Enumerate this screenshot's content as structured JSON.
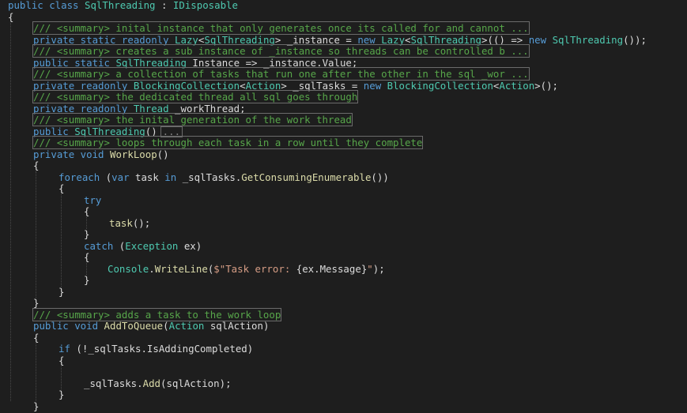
{
  "editor": {
    "lines": [
      [
        [
          "kw",
          "public class "
        ],
        [
          "ty",
          "SqlThreading"
        ],
        [
          "pn",
          " : "
        ],
        [
          "ty",
          "IDisposable"
        ]
      ],
      [
        [
          "pn",
          "{"
        ]
      ],
      [
        [
          "cm",
          "/// <summary> inital instance that only generates once its called for and cannot ..."
        ]
      ],
      [
        [
          "kw",
          "private static readonly "
        ],
        [
          "ty",
          "Lazy"
        ],
        [
          "pn",
          "<"
        ],
        [
          "ty",
          "SqlThreading"
        ],
        [
          "pn",
          "> "
        ],
        [
          "id",
          "_instance"
        ],
        [
          "pn",
          " = "
        ],
        [
          "kw",
          "new "
        ],
        [
          "ty",
          "Lazy"
        ],
        [
          "pn",
          "<"
        ],
        [
          "ty",
          "SqlThreading"
        ],
        [
          "pn",
          ">(() => "
        ],
        [
          "kw",
          "new "
        ],
        [
          "ty",
          "SqlThreading"
        ],
        [
          "pn",
          "());"
        ]
      ],
      [
        [
          "cm",
          "/// <summary> creates a sub instance of _instance so threads can be controlled b ..."
        ]
      ],
      [
        [
          "kw",
          "public static "
        ],
        [
          "ty",
          "SqlThreading"
        ],
        [
          "id",
          " Instance"
        ],
        [
          "pn",
          " => "
        ],
        [
          "id",
          "_instance"
        ],
        [
          "pn",
          "."
        ],
        [
          "id",
          "Value"
        ],
        [
          "pn",
          ";"
        ]
      ],
      [
        [
          "cm",
          "/// <summary> a collection of tasks that run one after the other in the sql _wor ..."
        ]
      ],
      [
        [
          "kw",
          "private readonly "
        ],
        [
          "ty",
          "BlockingCollection"
        ],
        [
          "pn",
          "<"
        ],
        [
          "ty",
          "Action"
        ],
        [
          "pn",
          "> "
        ],
        [
          "id",
          "_sqlTasks"
        ],
        [
          "pn",
          " = "
        ],
        [
          "kw",
          "new "
        ],
        [
          "ty",
          "BlockingCollection"
        ],
        [
          "pn",
          "<"
        ],
        [
          "ty",
          "Action"
        ],
        [
          "pn",
          ">();"
        ]
      ],
      [
        [
          "cm",
          "/// <summary> the dedicated thread all sql goes through"
        ]
      ],
      [
        [
          "kw",
          "private readonly "
        ],
        [
          "ty",
          "Thread"
        ],
        [
          "id",
          " _workThread"
        ],
        [
          "pn",
          ";"
        ]
      ],
      [
        [
          "cm",
          "/// <summary> the inital generation of the work thread"
        ]
      ],
      [
        [
          "kw",
          "public "
        ],
        [
          "ty",
          "SqlThreading"
        ],
        [
          "pn",
          "()"
        ]
      ],
      [
        [
          "cm",
          "/// <summary> loops through each task in a row until they complete"
        ]
      ],
      [
        [
          "kw",
          "private void "
        ],
        [
          "mt",
          "WorkLoop"
        ],
        [
          "pn",
          "()"
        ]
      ],
      [
        [
          "pn",
          "{"
        ]
      ],
      [
        [
          "kw",
          "foreach "
        ],
        [
          "pn",
          "("
        ],
        [
          "kw",
          "var "
        ],
        [
          "id",
          "task"
        ],
        [
          "kw",
          " in "
        ],
        [
          "id",
          "_sqlTasks"
        ],
        [
          "pn",
          "."
        ],
        [
          "mt",
          "GetConsumingEnumerable"
        ],
        [
          "pn",
          "())"
        ]
      ],
      [
        [
          "pn",
          "{"
        ]
      ],
      [
        [
          "kw",
          "try"
        ]
      ],
      [
        [
          "pn",
          "{"
        ]
      ],
      [
        [
          "mt",
          "task"
        ],
        [
          "pn",
          "();"
        ]
      ],
      [
        [
          "pn",
          "}"
        ]
      ],
      [
        [
          "kw",
          "catch "
        ],
        [
          "pn",
          "("
        ],
        [
          "ty",
          "Exception"
        ],
        [
          "id",
          " ex"
        ],
        [
          "pn",
          ")"
        ]
      ],
      [
        [
          "pn",
          "{"
        ]
      ],
      [
        [
          "ty",
          "Console"
        ],
        [
          "pn",
          "."
        ],
        [
          "mt",
          "WriteLine"
        ],
        [
          "pn",
          "("
        ],
        [
          "st",
          "$\"Task error: "
        ],
        [
          "pn",
          "{"
        ],
        [
          "id",
          "ex"
        ],
        [
          "pn",
          "."
        ],
        [
          "id",
          "Message"
        ],
        [
          "pn",
          "}"
        ],
        [
          "st",
          "\""
        ],
        [
          "pn",
          ");"
        ]
      ],
      [
        [
          "pn",
          "}"
        ]
      ],
      [
        [
          "pn",
          "}"
        ]
      ],
      [
        [
          "pn",
          "}"
        ]
      ],
      [
        [
          "cm",
          "/// <summary> adds a task to the work loop"
        ]
      ],
      [
        [
          "kw",
          "public void "
        ],
        [
          "mt",
          "AddToQueue"
        ],
        [
          "pn",
          "("
        ],
        [
          "ty",
          "Action"
        ],
        [
          "id",
          " sqlAction"
        ],
        [
          "pn",
          ")"
        ]
      ],
      [
        [
          "pn",
          "{"
        ]
      ],
      [
        [
          "kw",
          "if "
        ],
        [
          "pn",
          "(!"
        ],
        [
          "id",
          "_sqlTasks"
        ],
        [
          "pn",
          "."
        ],
        [
          "id",
          "IsAddingCompleted"
        ],
        [
          "pn",
          ")"
        ]
      ],
      [
        [
          "pn",
          "{"
        ]
      ],
      [
        [
          "pn",
          ""
        ]
      ],
      [
        [
          "id",
          "_sqlTasks"
        ],
        [
          "pn",
          "."
        ],
        [
          "mt",
          "Add"
        ],
        [
          "pn",
          "("
        ],
        [
          "id",
          "sqlAction"
        ],
        [
          "pn",
          ");"
        ]
      ],
      [
        [
          "pn",
          "}"
        ]
      ],
      [
        [
          "pn",
          "}"
        ]
      ]
    ],
    "collapsed_marker": "...",
    "colors": {
      "background": "#1e1e1e",
      "keyword": "#569cd6",
      "type": "#4ec9b0",
      "comment": "#57a64a",
      "string": "#d69d85",
      "method": "#dcdcaa",
      "text": "#dcdcdc"
    }
  }
}
